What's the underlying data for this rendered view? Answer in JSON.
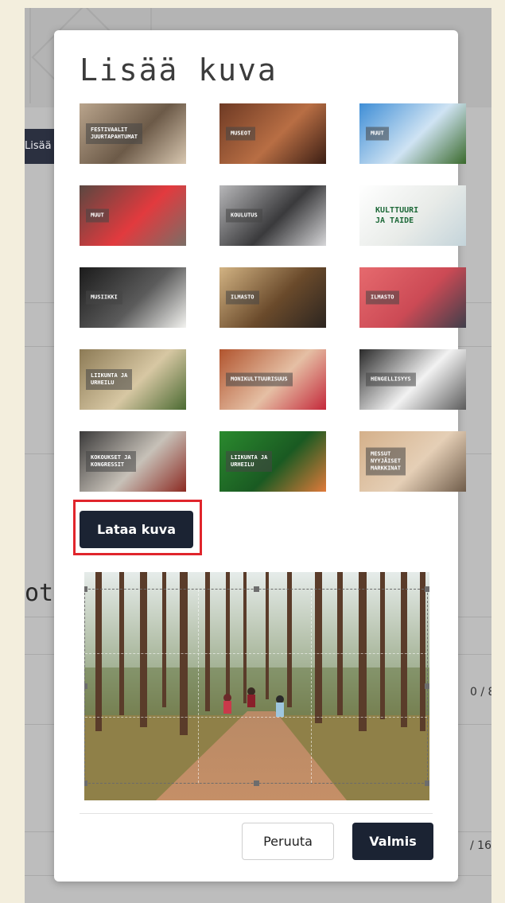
{
  "background": {
    "chip_text": "Lisää",
    "big_text": "ot",
    "count_1": "0 / 8",
    "count_2": "/ 16"
  },
  "modal": {
    "title": "Lisää kuva",
    "tiles": [
      {
        "label": "FESTIVAALIT\nJUURTAPAHTUMAT",
        "colors": [
          "#b9a48c",
          "#6c5a48",
          "#d8c7b0"
        ]
      },
      {
        "label": "MUSEOT",
        "colors": [
          "#6e3a24",
          "#b86e44",
          "#3b1e14"
        ]
      },
      {
        "label": "MUUT",
        "colors": [
          "#3f8ed6",
          "#cfe3f3",
          "#3a6a2c"
        ]
      },
      {
        "label": "MUUT",
        "colors": [
          "#5a4741",
          "#e23a3e",
          "#7a6e66"
        ]
      },
      {
        "label": "KOULUTUS",
        "colors": [
          "#b7b7b9",
          "#3a3a3c",
          "#d6d6d8"
        ]
      },
      {
        "label": "KULTTUURI\nJA TAIDE",
        "colors": [
          "#ffffff",
          "#e8ebe8",
          "#c4d4da"
        ],
        "light": true
      },
      {
        "label": "MUSIIKKI",
        "colors": [
          "#1b1b1b",
          "#5b5b5b",
          "#f3f3f0"
        ]
      },
      {
        "label": "ILMASTO",
        "colors": [
          "#d2b383",
          "#6a4a2b",
          "#2c2520"
        ]
      },
      {
        "label": "ILMASTO",
        "colors": [
          "#e66a6e",
          "#cc4a55",
          "#3f3f4b"
        ]
      },
      {
        "label": "LIIKUNTA JA\nURHEILU",
        "colors": [
          "#8c7a55",
          "#d7c7a3",
          "#4b6a32"
        ]
      },
      {
        "label": "MONIKULTTUURISUUS",
        "colors": [
          "#b1542e",
          "#e5bfa4",
          "#c4283a"
        ]
      },
      {
        "label": "HENGELLISYYS",
        "colors": [
          "#2a2a2a",
          "#f2f2f2",
          "#5b5b5b"
        ]
      },
      {
        "label": "KOKOUKSET JA\nKONGRESSIT",
        "colors": [
          "#3b3a3a",
          "#c7c1b8",
          "#8c2a22"
        ]
      },
      {
        "label": "LIIKUNTA JA\nURHEILU",
        "colors": [
          "#2a8a2e",
          "#1a5a22",
          "#e07a3a"
        ]
      },
      {
        "label": "MESSUT\nNYYJÄISET\nMARKKINAT",
        "colors": [
          "#d4b08a",
          "#e5cfb6",
          "#6f5c4a"
        ]
      }
    ],
    "upload_label": "Lataa kuva",
    "cancel_label": "Peruuta",
    "done_label": "Valmis"
  }
}
